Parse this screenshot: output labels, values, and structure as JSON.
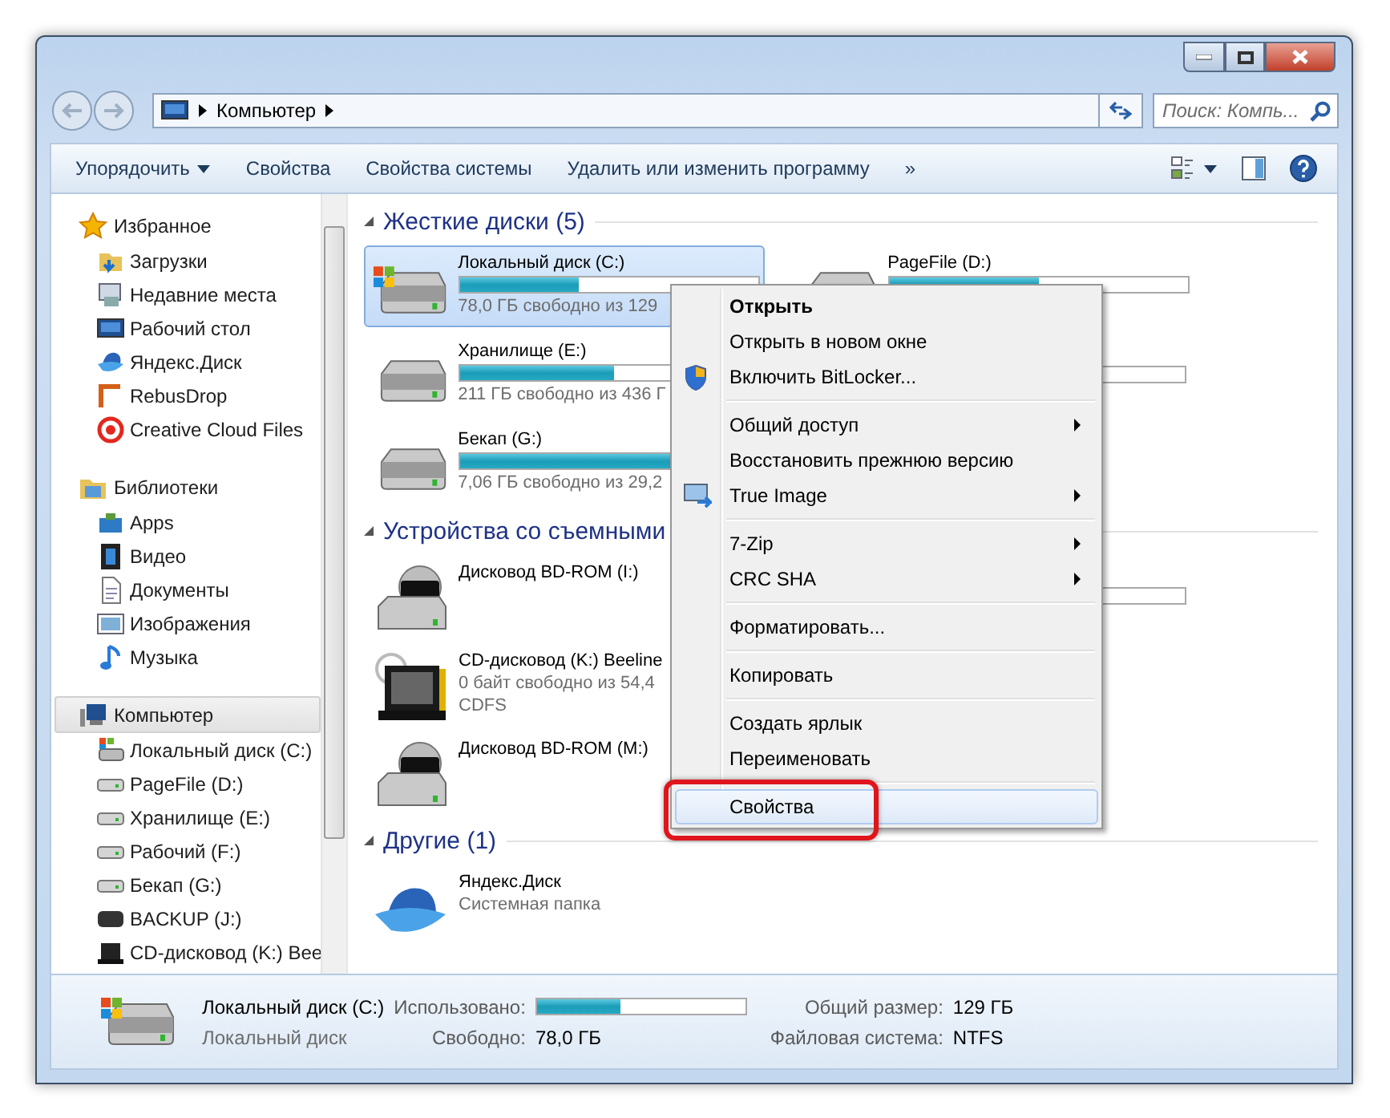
{
  "window": {
    "address": [
      "Компьютер"
    ],
    "search": {
      "placeholder": "Поиск: Компь..."
    }
  },
  "toolbar": {
    "items": [
      {
        "label": "Упорядочить",
        "has_menu": true
      },
      {
        "label": "Свойства",
        "has_menu": false
      },
      {
        "label": "Свойства системы",
        "has_menu": false
      },
      {
        "label": "Удалить или изменить программу",
        "has_menu": false
      },
      {
        "label": "»",
        "has_menu": false
      }
    ]
  },
  "sidebar": {
    "groups": [
      {
        "label": "Избранное",
        "selected": false,
        "children": [
          {
            "label": "Загрузки",
            "selected": false
          },
          {
            "label": "Недавние места",
            "selected": false
          },
          {
            "label": "Рабочий стол",
            "selected": false
          },
          {
            "label": "Яндекс.Диск",
            "selected": false
          },
          {
            "label": "RebusDrop",
            "selected": false
          },
          {
            "label": "Creative Cloud Files",
            "selected": false
          }
        ]
      },
      {
        "label": "Библиотеки",
        "selected": false,
        "children": [
          {
            "label": "Apps",
            "selected": false
          },
          {
            "label": "Видео",
            "selected": false
          },
          {
            "label": "Документы",
            "selected": false
          },
          {
            "label": "Изображения",
            "selected": false
          },
          {
            "label": "Музыка",
            "selected": false
          }
        ]
      },
      {
        "label": "Компьютер",
        "selected": true,
        "children": [
          {
            "label": "Локальный диск (C:)",
            "selected": false
          },
          {
            "label": "PageFile (D:)",
            "selected": false
          },
          {
            "label": "Хранилище (E:)",
            "selected": false
          },
          {
            "label": "Рабочий (F:)",
            "selected": false
          },
          {
            "label": "Бекап (G:)",
            "selected": false
          },
          {
            "label": "BACKUP (J:)",
            "selected": false
          },
          {
            "label": "CD-дисковод (K:) Bee",
            "selected": false
          }
        ]
      }
    ]
  },
  "content": {
    "sections": [
      {
        "title": "Жесткие диски (5)",
        "expanded": true,
        "columns": [
          [
            {
              "kind": "system-drive",
              "name": "Локальный диск (C:)",
              "level": 0.4,
              "free": "78,0 ГБ свободно из 129",
              "selected": true
            },
            {
              "kind": "drive",
              "name": "Хранилище (E:)",
              "level": 0.52,
              "free": "211 ГБ свободно из 436 Г",
              "selected": false
            },
            {
              "kind": "drive",
              "name": "Бекап (G:)",
              "level": 0.76,
              "free": "7,06 ГБ свободно из 29,2",
              "selected": false
            }
          ],
          [
            {
              "kind": "drive",
              "name": "PageFile (D:)",
              "level": 0.5,
              "selected": false
            },
            {
              "kind": "track",
              "selected": false
            }
          ]
        ]
      },
      {
        "title": "Устройства со съемными",
        "expanded": true,
        "columns": [
          [
            {
              "kind": "bd",
              "name": "Дисковод BD-ROM (I:)",
              "selected": false
            },
            {
              "kind": "cd",
              "name": "CD-дисковод (K:) Beeline",
              "free": "0 байт свободно из 54,4",
              "fs": "CDFS",
              "selected": false
            },
            {
              "kind": "bd",
              "name": "Дисковод BD-ROM (M:)",
              "selected": false
            }
          ],
          [
            {
              "kind": "track",
              "selected": false
            }
          ]
        ]
      },
      {
        "title": "Другие (1)",
        "expanded": true,
        "columns": [
          [
            {
              "kind": "cloud-folder",
              "name": "Яндекс.Диск",
              "sub": "Системная папка",
              "selected": false
            }
          ]
        ]
      }
    ]
  },
  "context_menu": {
    "items": [
      {
        "kind": "item",
        "label": "Открыть",
        "default": true,
        "submenu": false,
        "selected": false
      },
      {
        "kind": "item",
        "label": "Открыть в новом окне",
        "default": false,
        "submenu": false,
        "selected": false
      },
      {
        "kind": "item",
        "label": "Включить BitLocker...",
        "default": false,
        "submenu": false,
        "selected": false
      },
      {
        "kind": "separator"
      },
      {
        "kind": "item",
        "label": "Общий доступ",
        "default": false,
        "submenu": true,
        "selected": false
      },
      {
        "kind": "item",
        "label": "Восстановить прежнюю версию",
        "default": false,
        "submenu": false,
        "selected": false
      },
      {
        "kind": "item",
        "label": "True Image",
        "default": false,
        "submenu": true,
        "selected": false
      },
      {
        "kind": "separator"
      },
      {
        "kind": "item",
        "label": "7-Zip",
        "default": false,
        "submenu": true,
        "selected": false
      },
      {
        "kind": "item",
        "label": "CRC SHA",
        "default": false,
        "submenu": true,
        "selected": false
      },
      {
        "kind": "separator"
      },
      {
        "kind": "item",
        "label": "Форматировать...",
        "default": false,
        "submenu": false,
        "selected": false
      },
      {
        "kind": "separator"
      },
      {
        "kind": "item",
        "label": "Копировать",
        "default": false,
        "submenu": false,
        "selected": false
      },
      {
        "kind": "separator"
      },
      {
        "kind": "item",
        "label": "Создать ярлык",
        "default": false,
        "submenu": false,
        "selected": false
      },
      {
        "kind": "item",
        "label": "Переименовать",
        "default": false,
        "submenu": false,
        "selected": false
      },
      {
        "kind": "separator"
      },
      {
        "kind": "item",
        "label": "Свойства",
        "default": false,
        "submenu": false,
        "selected": true,
        "annotated": true
      }
    ]
  },
  "details": {
    "name": "Локальный диск (C:)",
    "type": "Локальный диск",
    "used_label": "Использовано:",
    "level": 0.4,
    "free_label": "Свободно:",
    "free": "78,0 ГБ",
    "size_label": "Общий размер:",
    "size": "129 ГБ",
    "fs_label": "Файловая система:",
    "fs": "NTFS"
  }
}
